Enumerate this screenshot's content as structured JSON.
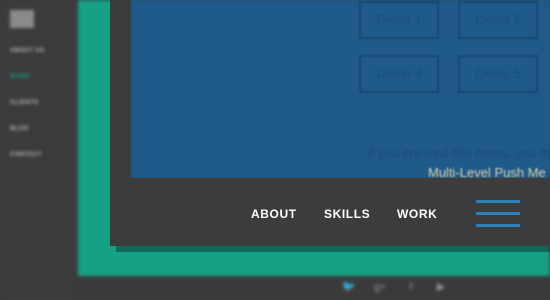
{
  "sidebar": {
    "items": [
      {
        "label": "About Us",
        "active": false
      },
      {
        "label": "Work",
        "active": true
      },
      {
        "label": "Clients",
        "active": false
      },
      {
        "label": "Blog",
        "active": false
      },
      {
        "label": "Contact",
        "active": false
      }
    ]
  },
  "content": {
    "demos": [
      "Demo 1",
      "Demo 2",
      "Demo 4",
      "Demo 5"
    ],
    "message": "If you enjoyed this menu, you m",
    "link": "Multi-Level Push Me"
  },
  "nav": {
    "items": [
      "ABOUT",
      "SKILLS",
      "WORK"
    ],
    "menu_icon": "hamburger-icon"
  },
  "footer": {
    "social_icons": [
      "twitter-icon",
      "google-plus-icon",
      "facebook-icon",
      "youtube-icon"
    ]
  },
  "colors": {
    "accent_green": "#16a085",
    "content_blue": "#1f5a8a",
    "menu_blue": "#2f7fb8",
    "dark": "#3d3c3d"
  }
}
